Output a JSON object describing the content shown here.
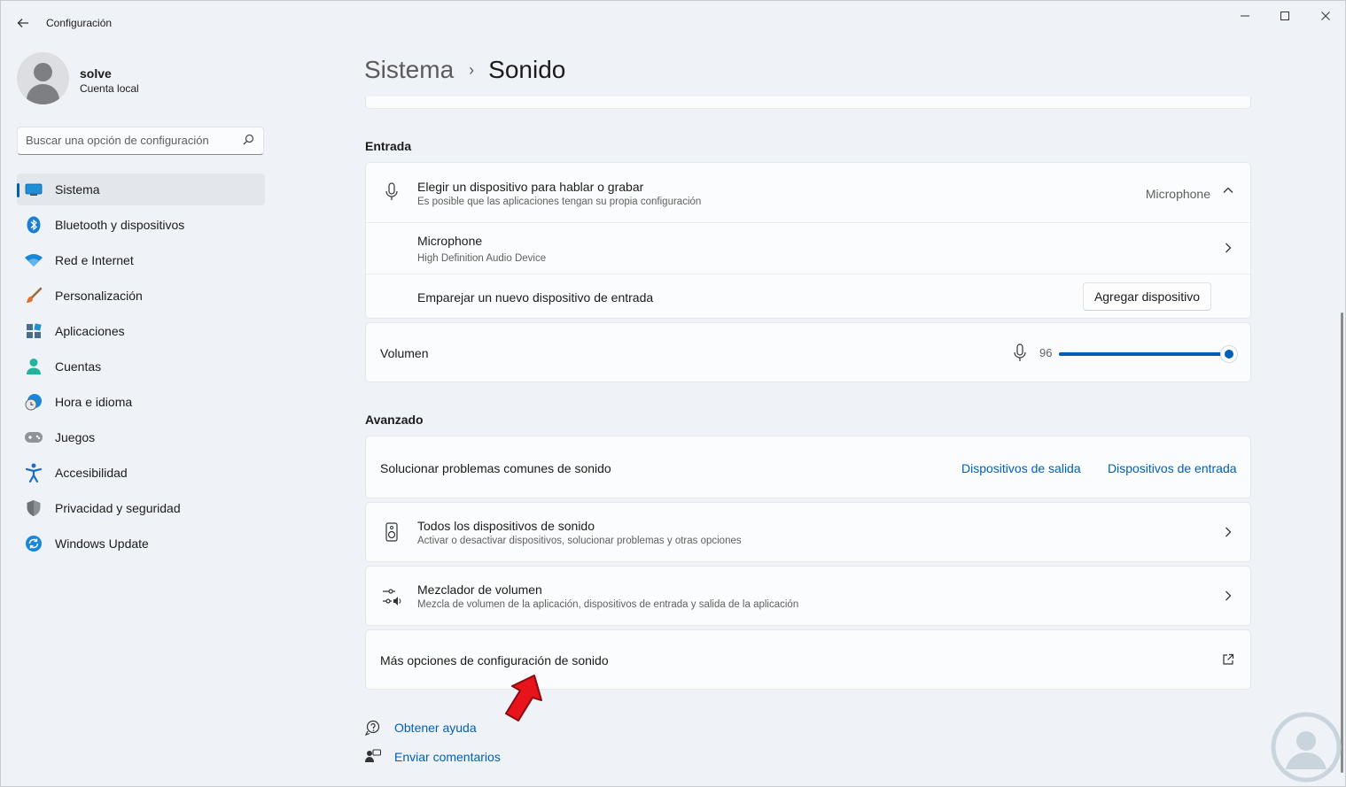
{
  "window": {
    "title": "Configuración",
    "back_label": "←",
    "min_label": "—",
    "max_label": "☐",
    "close_label": "✕"
  },
  "profile": {
    "name": "solve",
    "account_type": "Cuenta local"
  },
  "search": {
    "placeholder": "Buscar una opción de configuración"
  },
  "sidebar": {
    "items": [
      {
        "label": "Sistema",
        "icon": "monitor-icon",
        "active": true
      },
      {
        "label": "Bluetooth y dispositivos",
        "icon": "bluetooth-icon"
      },
      {
        "label": "Red e Internet",
        "icon": "wifi-icon"
      },
      {
        "label": "Personalización",
        "icon": "brush-icon"
      },
      {
        "label": "Aplicaciones",
        "icon": "apps-icon"
      },
      {
        "label": "Cuentas",
        "icon": "account-icon"
      },
      {
        "label": "Hora e idioma",
        "icon": "clock-globe-icon"
      },
      {
        "label": "Juegos",
        "icon": "gamepad-icon"
      },
      {
        "label": "Accesibilidad",
        "icon": "accessibility-icon"
      },
      {
        "label": "Privacidad y seguridad",
        "icon": "shield-icon"
      },
      {
        "label": "Windows Update",
        "icon": "update-icon"
      }
    ]
  },
  "breadcrumb": {
    "parent": "Sistema",
    "separator": "›",
    "current": "Sonido"
  },
  "input_section": {
    "title": "Entrada",
    "choose_device": {
      "title": "Elegir un dispositivo para hablar o grabar",
      "subtitle": "Es posible que las aplicaciones tengan su propia configuración",
      "value": "Microphone",
      "expanded": true
    },
    "device": {
      "title": "Microphone",
      "subtitle": "High Definition Audio Device"
    },
    "pair": {
      "title": "Emparejar un nuevo dispositivo de entrada",
      "button": "Agregar dispositivo"
    },
    "volume": {
      "label": "Volumen",
      "value": "96",
      "level": 0.96
    }
  },
  "advanced_section": {
    "title": "Avanzado",
    "troubleshoot": {
      "title": "Solucionar problemas comunes de sonido",
      "link_output": "Dispositivos de salida",
      "link_input": "Dispositivos de entrada"
    },
    "all_devices": {
      "title": "Todos los dispositivos de sonido",
      "subtitle": "Activar o desactivar dispositivos, solucionar problemas y otras opciones"
    },
    "mixer": {
      "title": "Mezclador de volumen",
      "subtitle": "Mezcla de volumen de la aplicación, dispositivos de entrada y salida de la aplicación"
    },
    "more_options": {
      "title": "Más opciones de configuración de sonido"
    }
  },
  "footer": {
    "help": "Obtener ayuda",
    "feedback": "Enviar comentarios"
  },
  "colors": {
    "accent": "#005fb8",
    "annotation_arrow": "#e8141c"
  }
}
